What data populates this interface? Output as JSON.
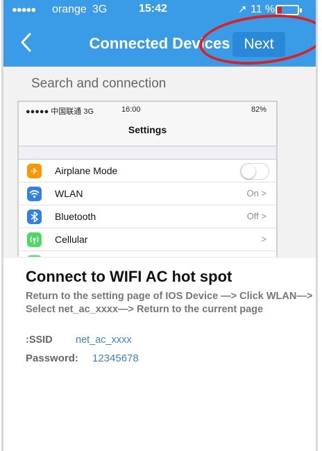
{
  "status_bar": {
    "signal": "●●●●●",
    "carrier": "orange",
    "network": "3G",
    "time": "15:42",
    "battery": "11 %",
    "battery_level": 0.11,
    "battery_color": "#e02020"
  },
  "nav": {
    "back_icon": "chevron-left-icon",
    "title": "Connected Devices",
    "next_label": "Next",
    "accent": "#3a9be6",
    "annotation_color": "#e02020"
  },
  "section_label": "Search and connection",
  "embedded_settings": {
    "status": {
      "left": "●●●●● 中国联通 3G",
      "time": "16:00",
      "battery": "82%"
    },
    "title": "Settings",
    "rows": [
      {
        "icon": "airplane-icon",
        "icon_color": "#ff9500",
        "label": "Airplane Mode",
        "value": "",
        "control": "toggle-off"
      },
      {
        "icon": "wifi-icon",
        "icon_color": "#2f80ed",
        "label": "WLAN",
        "value": "On >"
      },
      {
        "icon": "bluetooth-icon",
        "icon_color": "#2f80ed",
        "label": "Bluetooth",
        "value": "Off >"
      },
      {
        "icon": "cellular-icon",
        "icon_color": "#4cd964",
        "label": "Cellular",
        "value": ">"
      }
    ]
  },
  "instructions": {
    "heading": "Connect to WIFI AC hot spot",
    "description": "Return to the setting page of IOS Device —> Click WLAN—> Select net_ac_xxxx—> Return to the current page",
    "ssid_label": ":SSID",
    "ssid_value": "net_ac_xxxx",
    "password_label": "Password:",
    "password_value": "12345678"
  }
}
